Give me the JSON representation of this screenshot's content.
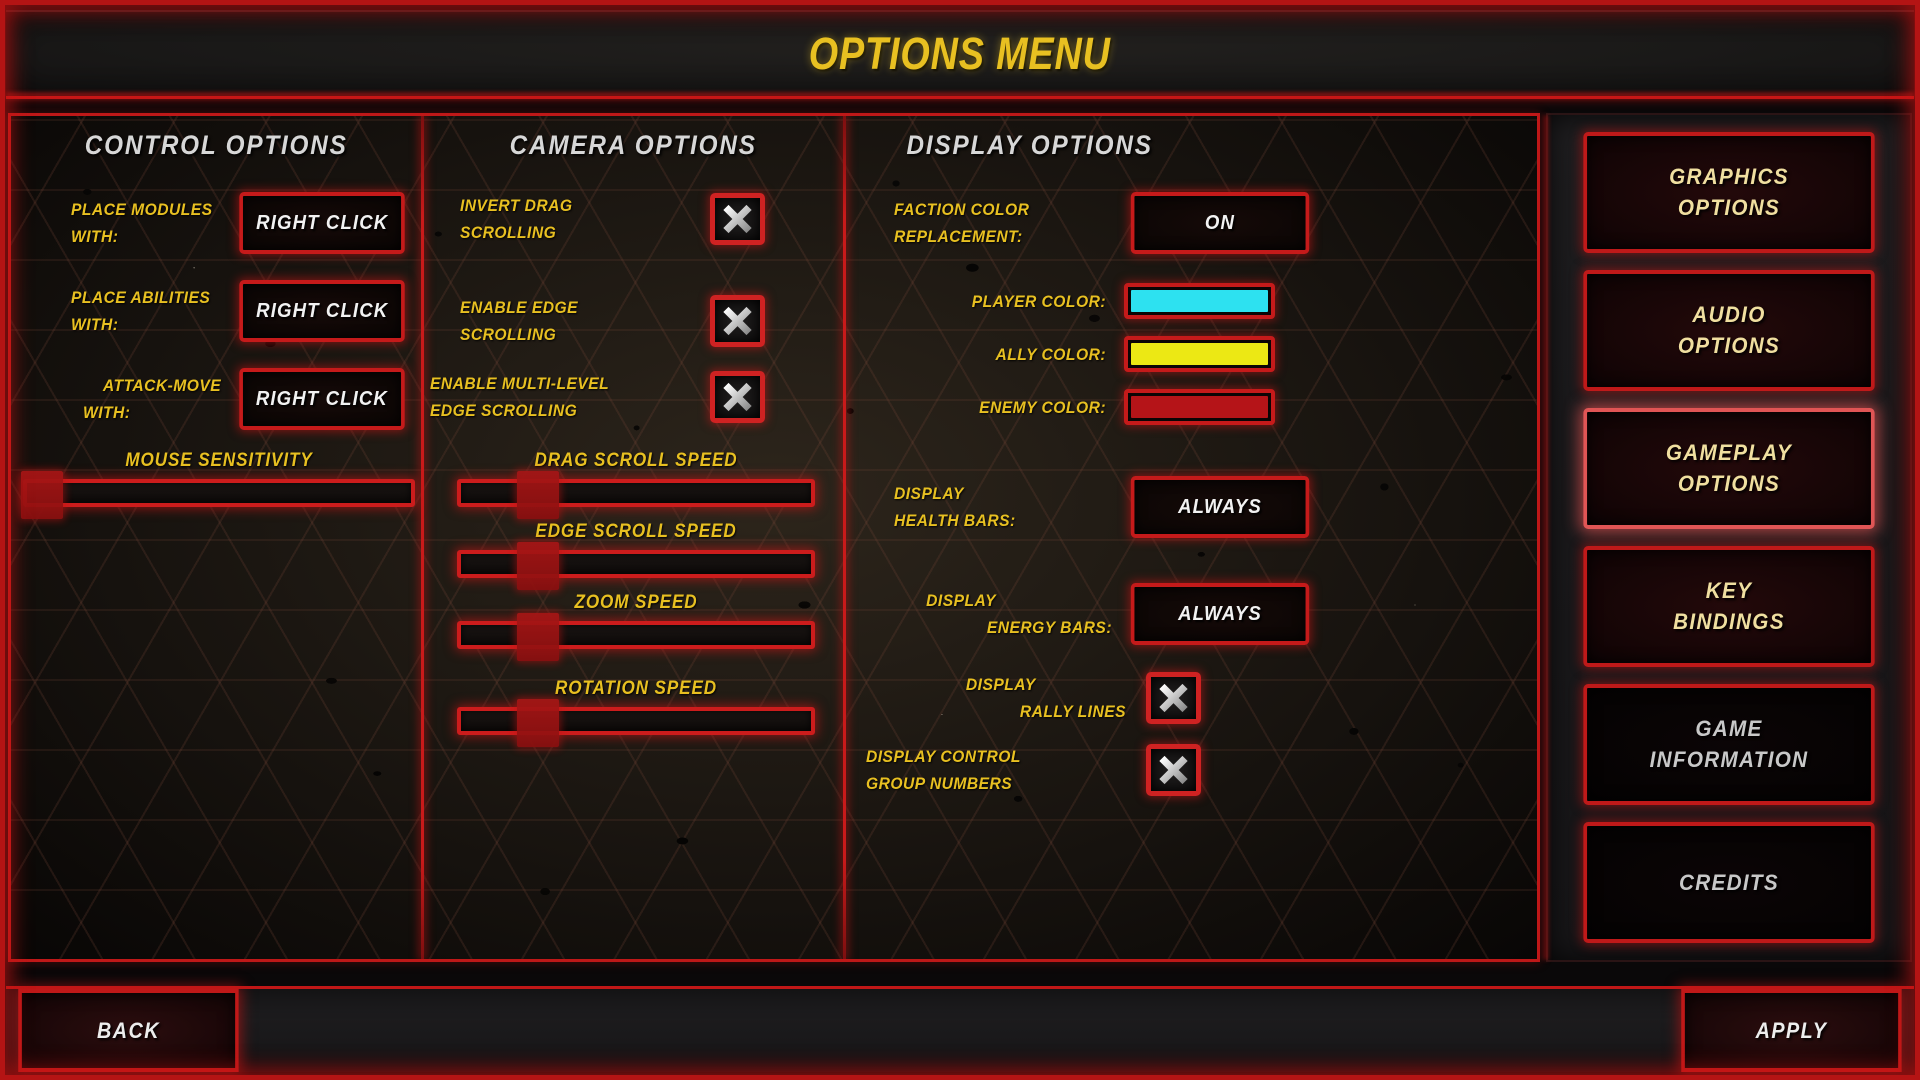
{
  "window": {
    "title": "OPTIONS MENU"
  },
  "colors": {
    "accent_red": "#c51a1a",
    "label_gold": "#e8c021",
    "header_gray": "#d7d7d7",
    "sidebar_text_gold": "#f0dfa0",
    "player_color": "#2de1f0",
    "ally_color": "#ece814",
    "enemy_color": "#b51418"
  },
  "control_options": {
    "header": "CONTROL OPTIONS",
    "rows": [
      {
        "label_line1": "PLACE MODULES",
        "label_line2": "WITH:",
        "value": "RIGHT CLICK"
      },
      {
        "label_line1": "PLACE ABILITIES",
        "label_line2": "WITH:",
        "value": "RIGHT CLICK"
      },
      {
        "label_line1": "ATTACK-MOVE",
        "label_line2": "WITH:",
        "value": "RIGHT CLICK"
      }
    ],
    "sliders": [
      {
        "label": "MOUSE SENSITIVITY",
        "value_pct": 4
      }
    ]
  },
  "camera_options": {
    "header": "CAMERA OPTIONS",
    "checkboxes": [
      {
        "label_line1": "INVERT DRAG",
        "label_line2": "SCROLLING",
        "checked": true,
        "icon": "x-mark-icon"
      },
      {
        "label_line1": "ENABLE EDGE",
        "label_line2": "SCROLLING",
        "checked": true,
        "icon": "x-mark-icon"
      },
      {
        "label_line1": "ENABLE MULTI-LEVEL",
        "label_line2": "EDGE SCROLLING",
        "checked": true,
        "icon": "x-mark-icon"
      }
    ],
    "sliders": [
      {
        "label": "DRAG SCROLL SPEED",
        "value_pct": 22
      },
      {
        "label": "EDGE SCROLL SPEED",
        "value_pct": 22
      },
      {
        "label": "ZOOM SPEED",
        "value_pct": 22
      },
      {
        "label": "ROTATION SPEED",
        "value_pct": 22
      }
    ]
  },
  "display_options": {
    "header": "DISPLAY OPTIONS",
    "faction_color_replacement": {
      "label_line1": "FACTION COLOR",
      "label_line2": "REPLACEMENT:",
      "value": "ON"
    },
    "color_swatches": [
      {
        "label": "PLAYER COLOR:",
        "color": "#2de1f0"
      },
      {
        "label": "ALLY COLOR:",
        "color": "#ece814"
      },
      {
        "label": "ENEMY COLOR:",
        "color": "#b51418"
      }
    ],
    "dropdowns": [
      {
        "label_line1": "DISPLAY",
        "label_line2": "HEALTH BARS:",
        "value": "ALWAYS"
      },
      {
        "label_line1": "DISPLAY",
        "label_line2": "ENERGY BARS:",
        "value": "ALWAYS"
      }
    ],
    "checkboxes": [
      {
        "label_line1": "DISPLAY",
        "label_line2": "RALLY LINES",
        "checked": true,
        "icon": "x-mark-icon"
      },
      {
        "label_line1": "DISPLAY CONTROL",
        "label_line2": "GROUP NUMBERS",
        "checked": true,
        "icon": "x-mark-icon"
      }
    ]
  },
  "sidebar": {
    "items": [
      {
        "line1": "GRAPHICS",
        "line2": "OPTIONS",
        "selected": false,
        "style": "gold"
      },
      {
        "line1": "AUDIO",
        "line2": "OPTIONS",
        "selected": false,
        "style": "gold"
      },
      {
        "line1": "GAMEPLAY",
        "line2": "OPTIONS",
        "selected": true,
        "style": "gold"
      },
      {
        "line1": "KEY",
        "line2": "BINDINGS",
        "selected": false,
        "style": "gold"
      },
      {
        "line1": "GAME",
        "line2": "INFORMATION",
        "selected": false,
        "style": "plain"
      },
      {
        "line1": "CREDITS",
        "line2": "",
        "selected": false,
        "style": "plain"
      }
    ]
  },
  "bottom_bar": {
    "back_label": "BACK",
    "apply_label": "APPLY"
  }
}
